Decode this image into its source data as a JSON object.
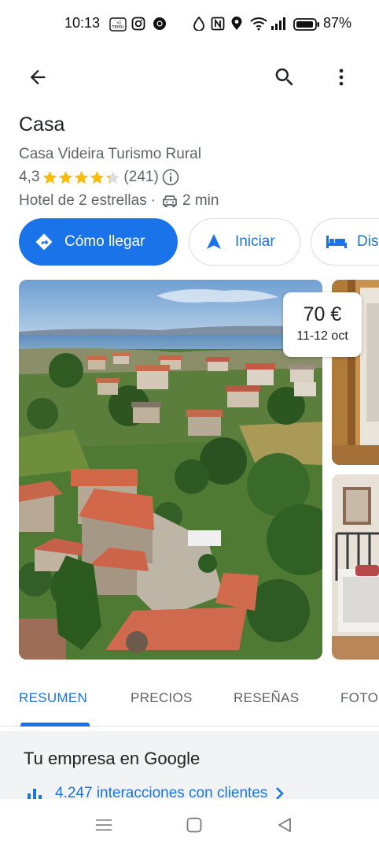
{
  "status_bar": {
    "time": "10:13",
    "battery_percent": "87%",
    "icons": [
      "temu-icon",
      "instagram-icon",
      "chrome-icon",
      "data-saver-icon",
      "nfc-icon",
      "location-icon",
      "wifi-icon",
      "signal-icon",
      "battery-icon"
    ]
  },
  "top_bar": {
    "back_icon": "arrow-left-icon",
    "search_icon": "search-icon",
    "more_icon": "more-vert-icon"
  },
  "place": {
    "title": "Casa",
    "subtitle": "Casa Videira Turismo Rural",
    "rating": "4,3",
    "rating_value": 4.3,
    "stars_max": 5,
    "review_count": "(241)",
    "hotel_type": "Hotel de 2 estrellas",
    "separator": "·",
    "drive_time": "2 min"
  },
  "actions": {
    "directions_label": "Cómo llegar",
    "start_label": "Iniciar",
    "availability_label": "Dis"
  },
  "photos": {
    "price": "70 €",
    "dates": "11-12 oct"
  },
  "tabs": [
    {
      "label": "RESUMEN",
      "active": true
    },
    {
      "label": "PRECIOS",
      "active": false
    },
    {
      "label": "RESEÑAS",
      "active": false
    },
    {
      "label": "FOTO",
      "active": false
    }
  ],
  "business": {
    "title": "Tu empresa en Google",
    "interactions": "4.247 interacciones con clientes"
  },
  "colors": {
    "accent": "#1a73e8",
    "star": "#fbbc04",
    "secondary_text": "#5f6368"
  }
}
